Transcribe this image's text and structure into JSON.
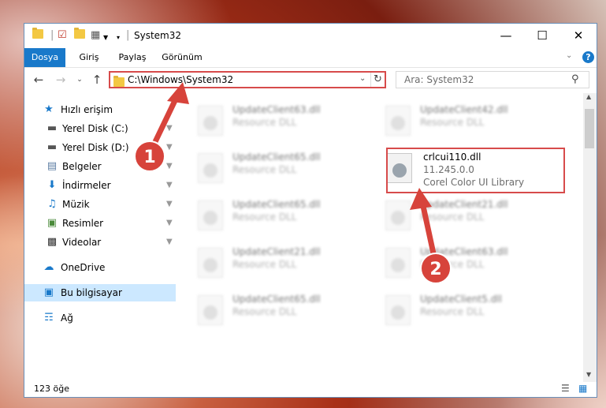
{
  "window": {
    "title": "System32",
    "controls": [
      "minimize",
      "maximize",
      "close"
    ]
  },
  "ribbon": {
    "tabs": [
      {
        "label": "Dosya",
        "active": true
      },
      {
        "label": "Giriş",
        "active": false
      },
      {
        "label": "Paylaş",
        "active": false
      },
      {
        "label": "Görünüm",
        "active": false
      }
    ]
  },
  "nav": {
    "address": "C:\\Windows\\System32",
    "search_placeholder": "Ara: System32"
  },
  "sidebar": {
    "items": [
      {
        "label": "Hızlı erişim",
        "icon": "star-icon",
        "pinned": false
      },
      {
        "label": "Yerel Disk (C:)",
        "icon": "drive-icon",
        "pinned": true
      },
      {
        "label": "Yerel Disk (D:)",
        "icon": "drive-icon",
        "pinned": true
      },
      {
        "label": "Belgeler",
        "icon": "document-icon",
        "pinned": true
      },
      {
        "label": "İndirmeler",
        "icon": "download-icon",
        "pinned": true
      },
      {
        "label": "Müzik",
        "icon": "music-icon",
        "pinned": true
      },
      {
        "label": "Resimler",
        "icon": "pictures-icon",
        "pinned": true
      },
      {
        "label": "Videolar",
        "icon": "video-icon",
        "pinned": true
      },
      {
        "label": "OneDrive",
        "icon": "cloud-icon",
        "pinned": false
      },
      {
        "label": "Bu bilgisayar",
        "icon": "computer-icon",
        "pinned": false,
        "selected": true
      },
      {
        "label": "Ağ",
        "icon": "network-icon",
        "pinned": false
      }
    ]
  },
  "files": {
    "left": [
      {
        "name": "UpdateClient63.dll",
        "type": "Resource DLL"
      },
      {
        "name": "UpdateClient65.dll",
        "type": "Resource DLL"
      },
      {
        "name": "UpdateClient65.dll",
        "type": "Resource DLL"
      },
      {
        "name": "UpdateClient21.dll",
        "type": "Resource DLL"
      },
      {
        "name": "UpdateClient65.dll",
        "type": "Resource DLL"
      }
    ],
    "right": [
      {
        "name": "UpdateClient42.dll",
        "type": "Resource DLL"
      },
      {
        "name": "crlcui110.dll",
        "version": "11.245.0.0",
        "type": "Corel Color UI Library",
        "highlighted": true
      },
      {
        "name": "UpdateClient21.dll",
        "type": "Resource DLL"
      },
      {
        "name": "UpdateClient63.dll",
        "type": "Resource DLL"
      },
      {
        "name": "UpdateClient5.dll",
        "type": "Resource DLL"
      }
    ]
  },
  "status": {
    "count": "123 öğe"
  },
  "annotations": {
    "badge1": "1",
    "badge2": "2",
    "color": "#d7433b"
  }
}
